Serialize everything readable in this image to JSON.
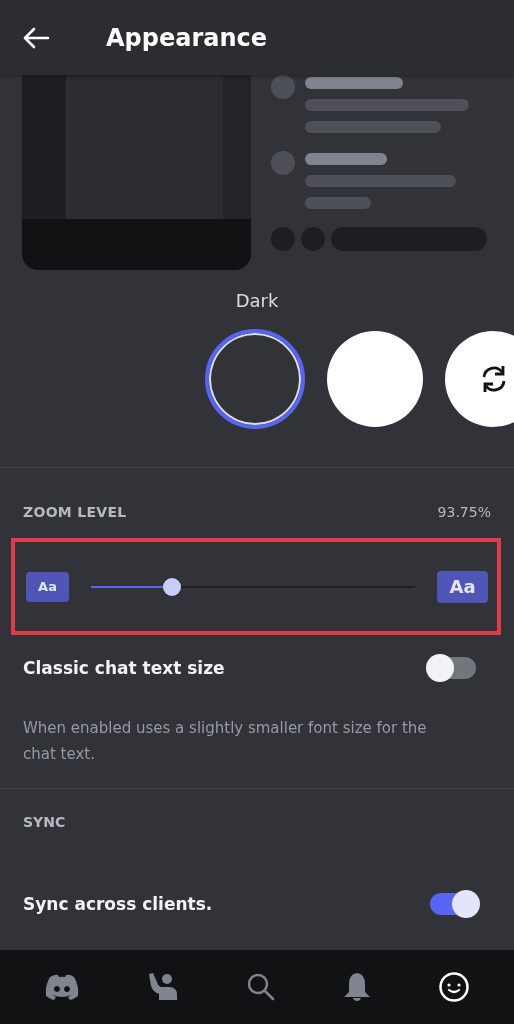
{
  "header": {
    "title": "Appearance"
  },
  "theme_preview": {
    "label": "Dark"
  },
  "themes": [
    {
      "kind": "dark",
      "selected": true
    },
    {
      "kind": "light",
      "selected": false
    },
    {
      "kind": "sync",
      "selected": false
    }
  ],
  "zoom": {
    "label": "ZOOM LEVEL",
    "reading": "93.75%",
    "level": 0.25,
    "small_label": "Aa",
    "large_label": "Aa",
    "highlighted": true
  },
  "classic": {
    "label": "Classic chat text size",
    "on": false,
    "description": "When enabled uses a slightly smaller font size for the chat text."
  },
  "sync": {
    "heading": "SYNC",
    "label": "Sync across clients.",
    "on": true
  },
  "nav": [
    {
      "kind": "home",
      "selected": false
    },
    {
      "kind": "friends",
      "selected": false
    },
    {
      "kind": "search",
      "selected": false
    },
    {
      "kind": "notifications",
      "selected": false
    },
    {
      "kind": "profile",
      "selected": true
    }
  ]
}
